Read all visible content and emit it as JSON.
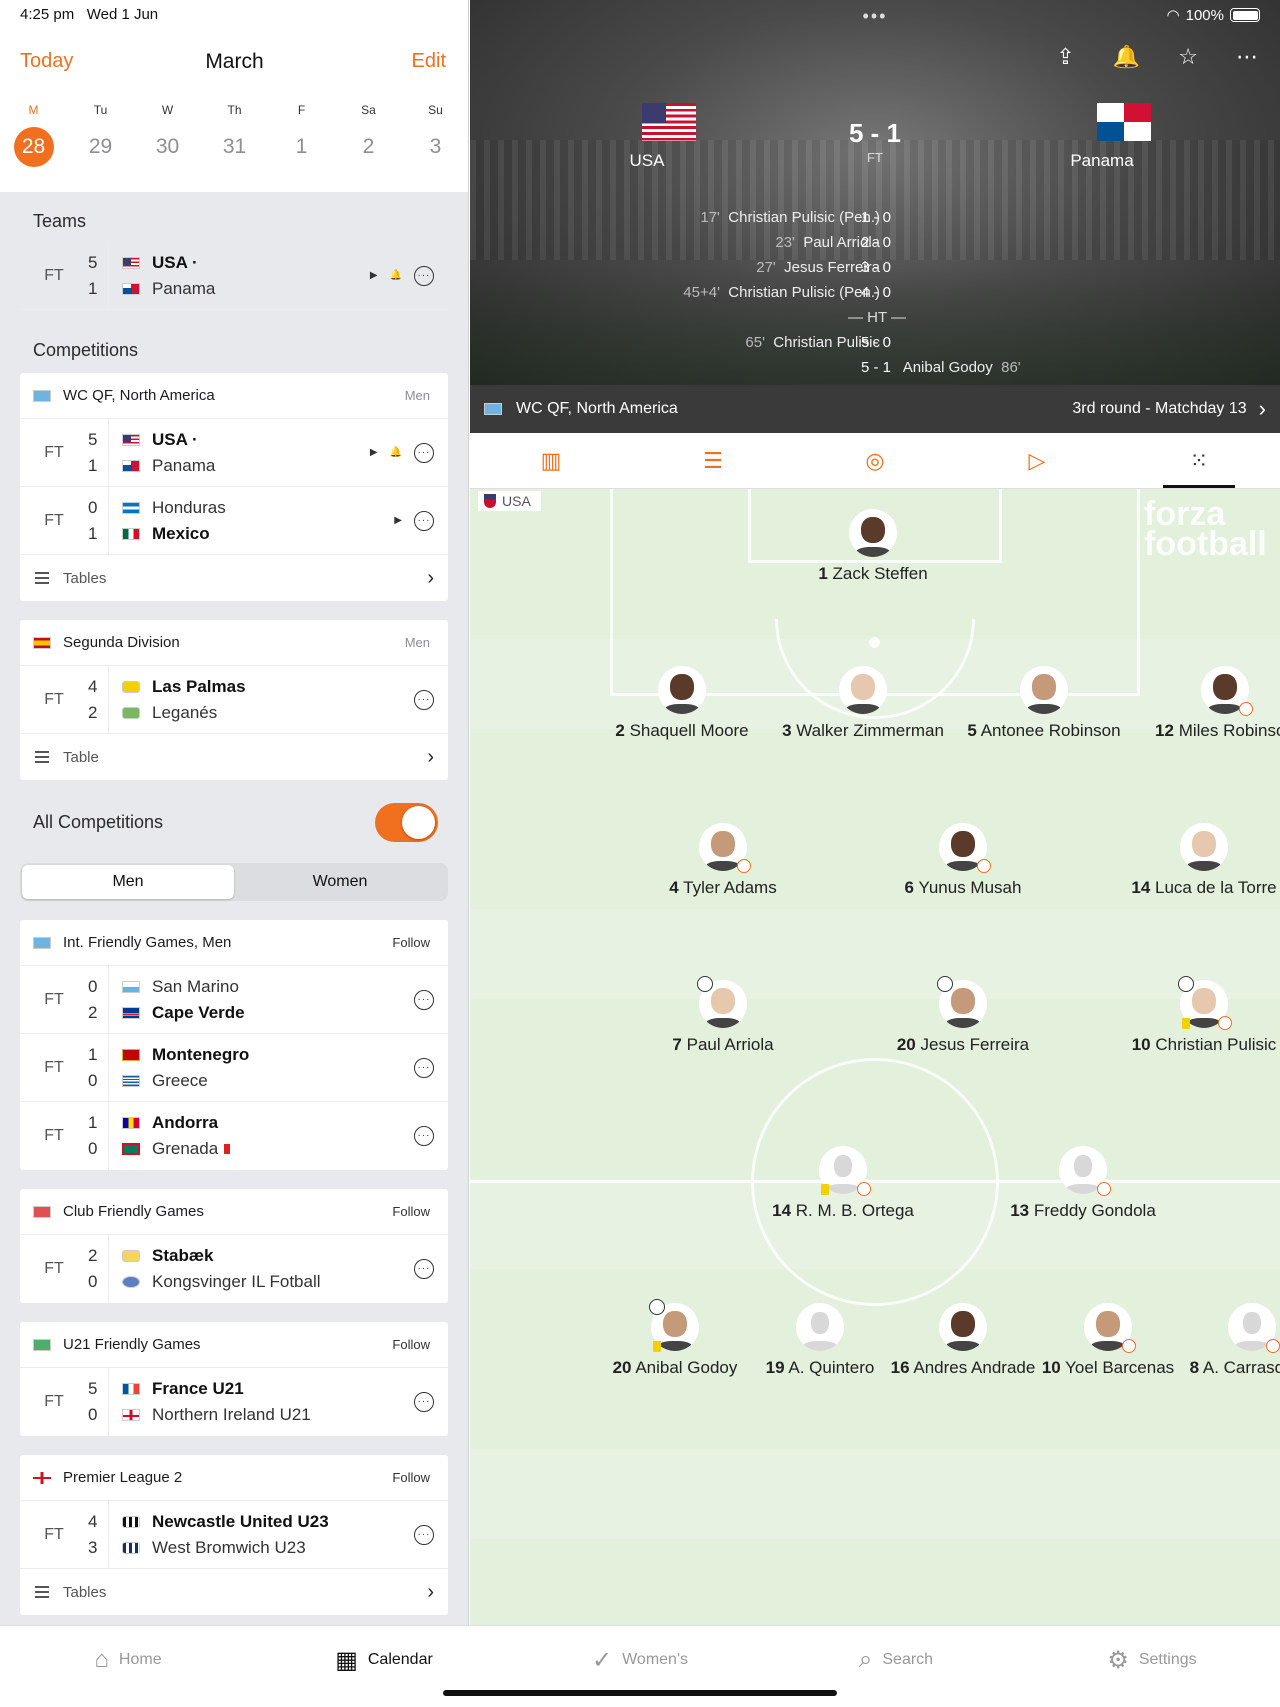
{
  "status": {
    "time": "4:25 pm",
    "date": "Wed 1 Jun",
    "battery": "100%"
  },
  "calendar": {
    "today_label": "Today",
    "month": "March",
    "edit_label": "Edit",
    "days": [
      {
        "letter": "M",
        "num": "28",
        "active": true
      },
      {
        "letter": "Tu",
        "num": "29"
      },
      {
        "letter": "W",
        "num": "30"
      },
      {
        "letter": "Th",
        "num": "31"
      },
      {
        "letter": "F",
        "num": "1"
      },
      {
        "letter": "Sa",
        "num": "2"
      },
      {
        "letter": "Su",
        "num": "3"
      }
    ]
  },
  "teams_section": {
    "title": "Teams",
    "match": {
      "status": "FT",
      "home_score": "5",
      "away_score": "1",
      "home": "USA ·",
      "away": "Panama"
    }
  },
  "competitions_section": {
    "title": "Competitions",
    "wc": {
      "name": "WC QF, North America",
      "tag": "Men",
      "matches": [
        {
          "status": "FT",
          "home_score": "5",
          "away_score": "1",
          "home": "USA ·",
          "away": "Panama"
        },
        {
          "status": "FT",
          "home_score": "0",
          "away_score": "1",
          "home": "Honduras",
          "away": "Mexico"
        }
      ],
      "footer": "Tables"
    },
    "segunda": {
      "name": "Segunda Division",
      "tag": "Men",
      "matches": [
        {
          "status": "FT",
          "home_score": "4",
          "away_score": "2",
          "home": "Las Palmas",
          "away": "Leganés"
        }
      ],
      "footer": "Table"
    }
  },
  "all_competitions": {
    "title": "All Competitions",
    "toggle_on": true,
    "segments": [
      "Men",
      "Women"
    ],
    "friendly": {
      "name": "Int. Friendly Games, Men",
      "follow": "Follow",
      "matches": [
        {
          "status": "FT",
          "home_score": "0",
          "away_score": "2",
          "home": "San Marino",
          "away": "Cape Verde"
        },
        {
          "status": "FT",
          "home_score": "1",
          "away_score": "0",
          "home": "Montenegro",
          "away": "Greece"
        },
        {
          "status": "FT",
          "home_score": "1",
          "away_score": "0",
          "home": "Andorra",
          "away": "Grenada"
        }
      ]
    },
    "club": {
      "name": "Club Friendly Games",
      "follow": "Follow",
      "matches": [
        {
          "status": "FT",
          "home_score": "2",
          "away_score": "0",
          "home": "Stabæk",
          "away": "Kongsvinger IL Fotball"
        }
      ]
    },
    "u21": {
      "name": "U21 Friendly Games",
      "follow": "Follow",
      "matches": [
        {
          "status": "FT",
          "home_score": "5",
          "away_score": "0",
          "home": "France U21",
          "away": "Northern Ireland U21"
        }
      ]
    },
    "pl2": {
      "name": "Premier League 2",
      "follow": "Follow",
      "matches": [
        {
          "status": "FT",
          "home_score": "4",
          "away_score": "3",
          "home": "Newcastle United U23",
          "away": "West Bromwich U23"
        }
      ],
      "footer": "Tables"
    }
  },
  "match_header": {
    "home": "USA",
    "away": "Panama",
    "score": "5 - 1",
    "status": "FT",
    "goals": [
      {
        "min": "17'",
        "text": "Christian Pulisic (Pen.)",
        "score": "1 - 0"
      },
      {
        "min": "23'",
        "text": "Paul Arriola",
        "score": "2 - 0"
      },
      {
        "min": "27'",
        "text": "Jesus Ferreira",
        "score": "3 - 0"
      },
      {
        "min": "45+4'",
        "text": "Christian Pulisic (Pen.)",
        "score": "4 - 0"
      },
      {
        "min": "65'",
        "text": "Christian Pulisic",
        "score": "5 - 0"
      }
    ],
    "ht": "— HT —",
    "away_goal": {
      "score": "5 - 1",
      "text": "Anibal Godoy",
      "min": "86'"
    },
    "competition": "WC QF, North America",
    "round": "3rd round - Matchday 13"
  },
  "lineup": {
    "side_label": "USA",
    "watermark": "forza football",
    "players": [
      {
        "num": "1",
        "name": "Zack Steffen",
        "skin": "dark"
      },
      {
        "num": "2",
        "name": "Shaquell Moore",
        "skin": "dark"
      },
      {
        "num": "3",
        "name": "Walker Zimmerman",
        "skin": "light"
      },
      {
        "num": "5",
        "name": "Antonee Robinson",
        "skin": "mid"
      },
      {
        "num": "12",
        "name": "Miles Robinson",
        "skin": "dark"
      },
      {
        "num": "4",
        "name": "Tyler Adams",
        "skin": "mid"
      },
      {
        "num": "6",
        "name": "Yunus Musah",
        "skin": "dark"
      },
      {
        "num": "14",
        "name": "Luca de la Torre",
        "skin": "light"
      },
      {
        "num": "7",
        "name": "Paul Arriola",
        "skin": "light"
      },
      {
        "num": "20",
        "name": "Jesus Ferreira",
        "skin": "mid"
      },
      {
        "num": "10",
        "name": "Christian Pulisic",
        "skin": "light"
      },
      {
        "num": "14",
        "name": "R. M. B. Ortega",
        "skin": "gen"
      },
      {
        "num": "13",
        "name": "Freddy Gondola",
        "skin": "gen"
      },
      {
        "num": "20",
        "name": "Anibal Godoy",
        "skin": "mid"
      },
      {
        "num": "19",
        "name": "A. Quintero",
        "skin": "gen"
      },
      {
        "num": "16",
        "name": "Andres Andrade",
        "skin": "dark"
      },
      {
        "num": "10",
        "name": "Yoel Barcenas",
        "skin": "mid"
      },
      {
        "num": "8",
        "name": "A. Carrasquilla",
        "skin": "gen"
      }
    ]
  },
  "tabbar": [
    {
      "label": "Home",
      "icon": "home-icon"
    },
    {
      "label": "Calendar",
      "icon": "calendar-icon",
      "active": true
    },
    {
      "label": "Women's",
      "icon": "nike-swoosh-icon"
    },
    {
      "label": "Search",
      "icon": "search-icon"
    },
    {
      "label": "Settings",
      "icon": "gear-icon"
    }
  ],
  "colors": {
    "accent": "#f07020",
    "pitch": "#e2f0dc"
  }
}
